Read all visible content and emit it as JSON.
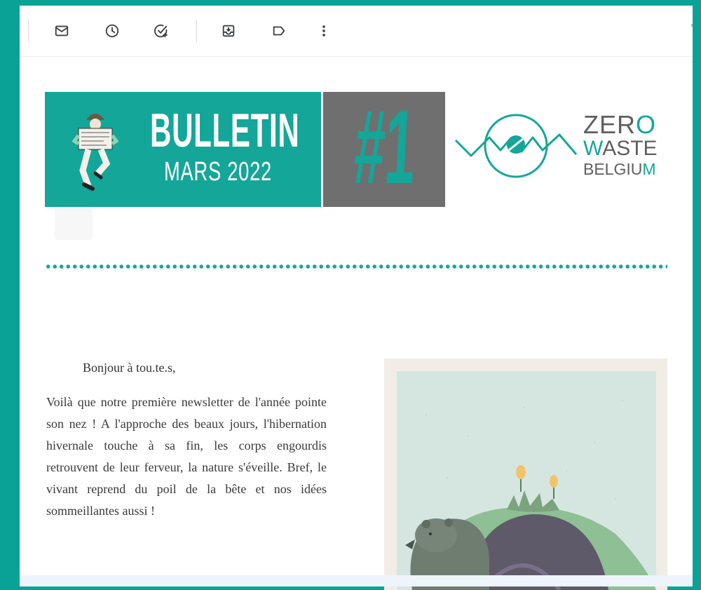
{
  "toolbar": {
    "icons": [
      "mail-icon",
      "clock-icon",
      "add-task-icon",
      "move-to-inbox-icon",
      "label-icon",
      "more-vert-icon"
    ]
  },
  "banner": {
    "title": "BULLETIN",
    "subtitle": "MARS 2022",
    "issue": "#1"
  },
  "logo": {
    "line1_a": "ZER",
    "line1_b": "O",
    "line2_a": "W",
    "line2_b": "ASTE",
    "line3_a": "BELGIU",
    "line3_b": "M"
  },
  "content": {
    "greeting": "Bonjour à tou.te.s,",
    "paragraph": "Voilà que notre première newsletter de l'année pointe son nez ! A l'approche des beaux jours, l'hibernation hivernale touche à sa fin, les corps engourdis retrouvent de leur ferveur, la nature s'éveille. Bref, le vivant reprend du poil de la bête et nos idées sommeillantes aussi !"
  },
  "colors": {
    "brand_teal": "#14a699",
    "banner_grey": "#6f6f6f",
    "page_background": "#0aa296"
  }
}
